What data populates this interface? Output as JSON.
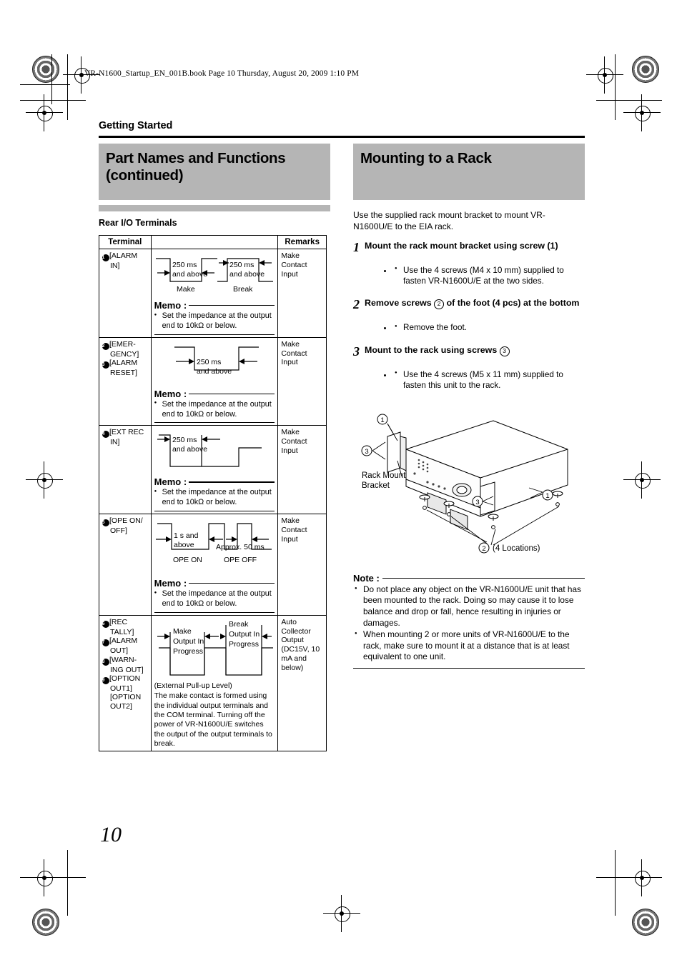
{
  "print_header": "VR-N1600_Startup_EN_001B.book  Page 10  Thursday, August 20, 2009  1:10 PM",
  "section_label": "Getting Started",
  "page_number": "10",
  "left_column": {
    "title": "Part Names and Functions (continued)",
    "subheading": "Rear I/O Terminals",
    "table": {
      "headers": {
        "terminal": "Terminal",
        "diagram": "",
        "remarks": "Remarks"
      },
      "rows": [
        {
          "terminal_lines": [
            "③①[ALARM",
            "IN]"
          ],
          "terminal_badges": [
            "31"
          ],
          "terminal_text": [
            "[ALARM",
            "IN]"
          ],
          "diagram_labels": {
            "pulse1_top": "250 ms",
            "pulse1_bot": "and above",
            "pulse1_name": "Make",
            "pulse2_top": "250 ms",
            "pulse2_bot": "and above",
            "pulse2_name": "Break"
          },
          "memo_title": "Memo :",
          "memo_items": [
            "Set the impedance at the output end to 10kΩ or below."
          ],
          "remarks": "Make Contact Input"
        },
        {
          "terminal_badges": [
            "32",
            "33"
          ],
          "terminal_text": [
            "[EMER-",
            "GENCY]",
            "[ALARM",
            "RESET]"
          ],
          "diagram_labels": {
            "pulse1_top": "250 ms",
            "pulse1_bot": "and above"
          },
          "memo_title": "Memo :",
          "memo_items": [
            "Set the impedance at the output end to 10kΩ or below."
          ],
          "remarks": "Make Contact Input"
        },
        {
          "terminal_badges": [
            "34"
          ],
          "terminal_text": [
            "[EXT REC",
            "IN]"
          ],
          "diagram_labels": {
            "pulse1_top": "250 ms",
            "pulse1_bot": "and above"
          },
          "memo_title": "Memo :",
          "memo_items": [
            "Set the impedance at the output end to 10kΩ or below."
          ],
          "remarks": "Make Contact Input"
        },
        {
          "terminal_badges": [
            "35"
          ],
          "terminal_text": [
            "[OPE ON/",
            "OFF]"
          ],
          "diagram_labels": {
            "pulse1_top": "1 s and",
            "pulse1_bot": "above",
            "pulse1_name": "OPE ON",
            "pulse2_top": "Approx. 50 ms",
            "pulse2_name": "OPE OFF"
          },
          "memo_title": "Memo :",
          "memo_items": [
            "Set the impedance at the output end to 10kΩ or below."
          ],
          "remarks": "Make Contact Input"
        },
        {
          "terminal_badges": [
            "36",
            "37",
            "38",
            "39"
          ],
          "terminal_text": [
            "[REC",
            "TALLY]",
            "[ALARM",
            "OUT]",
            "[WARN-",
            "ING OUT]",
            "[OPTION",
            "OUT1]",
            "[OPTION",
            "OUT2]"
          ],
          "diagram_labels": {
            "pulse1_l1": "Make",
            "pulse1_l2": "Output In",
            "pulse1_l3": "Progress",
            "pulse2_l1": "Break",
            "pulse2_l2": "Output In",
            "pulse2_l3": "Progress"
          },
          "pull_up_note": "(External Pull-up Level)",
          "body_text": "The make contact is formed using the individual output terminals and the COM terminal. Turning off the power of VR-N1600U/E switches the output of the output terminals to break.",
          "remarks": "Auto Collector Output (DC15V, 10 mA and below)"
        }
      ]
    }
  },
  "right_column": {
    "title": "Mounting to a Rack",
    "intro": "Use the supplied rack mount bracket to mount VR-N1600U/E to the EIA rack.",
    "steps": [
      {
        "number": "1",
        "title_before": "Mount the rack mount bracket using screw (1)",
        "bullets": [
          "Use the 4 screws (M4 x 10 mm) supplied to fasten VR-N1600U/E at the two sides."
        ]
      },
      {
        "number": "2",
        "title_before": "Remove screws",
        "callout": "2",
        "title_after": "of the foot (4 pcs) at the bottom",
        "bullets": [
          "Remove the foot."
        ]
      },
      {
        "number": "3",
        "title_before": "Mount to the rack using screws",
        "callout": "3",
        "title_after": "",
        "bullets": [
          "Use the 4 screws (M5 x 11 mm) supplied to fasten this unit to the rack."
        ]
      }
    ],
    "figure": {
      "callout_1a": "1",
      "callout_1b": "1",
      "callout_2": "2",
      "callout_3a": "3",
      "callout_3b": "3",
      "bracket_label_l1": "Rack Mount",
      "bracket_label_l2": "Bracket",
      "locations_label": "(4 Locations)"
    },
    "note": {
      "title": "Note :",
      "items": [
        "Do not place any object on the VR-N1600U/E unit that has been mounted to the rack. Doing so may cause it to lose balance and drop or fall, hence resulting in injuries or damages.",
        "When mounting 2 or more units of VR-N1600U/E to the rack, make sure to mount it at a distance that is at least equivalent to one unit."
      ]
    }
  }
}
